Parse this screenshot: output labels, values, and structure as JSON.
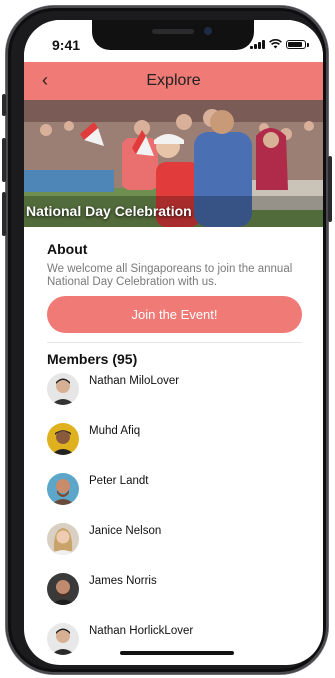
{
  "status_bar": {
    "time": "9:41"
  },
  "nav": {
    "title": "Explore",
    "back_icon": "chevron-left-icon"
  },
  "hero": {
    "title": "National Day Celebration"
  },
  "about": {
    "heading": "About",
    "text": "We welcome all Singaporeans to join the annual National Day Celebration with us."
  },
  "join_button": {
    "label": "Join the Event!"
  },
  "members": {
    "heading": "Members (95)",
    "items": [
      {
        "name": "Nathan MiloLover"
      },
      {
        "name": "Muhd Afiq"
      },
      {
        "name": "Peter Landt"
      },
      {
        "name": "Janice Nelson"
      },
      {
        "name": "James Norris"
      },
      {
        "name": "Nathan HorlickLover"
      }
    ]
  },
  "colors": {
    "accent": "#ef7a76",
    "text": "#111111",
    "muted": "#7a7a7a"
  }
}
